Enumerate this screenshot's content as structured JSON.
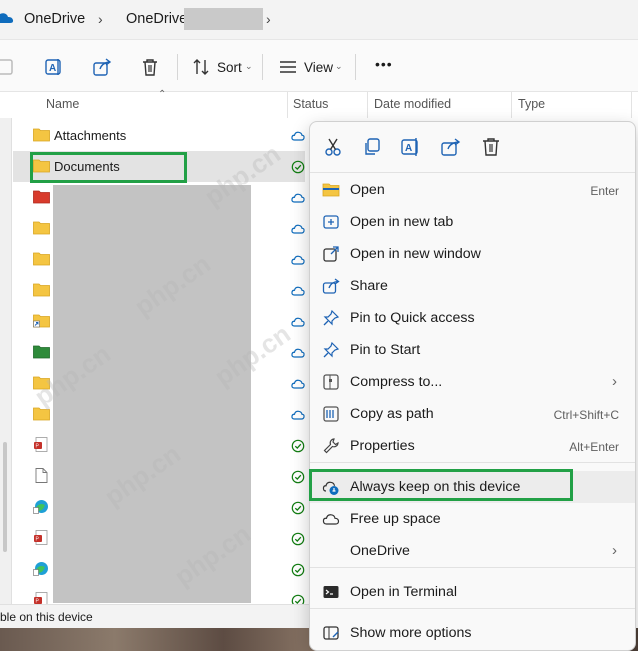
{
  "breadcrumb": {
    "root": "OneDrive",
    "current": "OneDrive"
  },
  "toolbar": {
    "sort_label": "Sort",
    "view_label": "View",
    "more_label": "•••"
  },
  "columns": {
    "name": "Name",
    "status": "Status",
    "date_modified": "Date modified",
    "type": "Type"
  },
  "files": [
    {
      "name": "Attachments",
      "icon": "folder-icon",
      "status": "cloud"
    },
    {
      "name": "Documents",
      "icon": "folder-icon",
      "status": "synced",
      "selected": true
    },
    {
      "name": "",
      "icon": "red-folder-icon",
      "status": "cloud"
    },
    {
      "name": "",
      "icon": "folder-icon",
      "status": "cloud"
    },
    {
      "name": "",
      "icon": "folder-icon",
      "status": "cloud"
    },
    {
      "name": "",
      "icon": "folder-icon",
      "status": "cloud"
    },
    {
      "name": "",
      "icon": "shortcut-icon",
      "status": "cloud"
    },
    {
      "name": "",
      "icon": "green-folder-icon",
      "status": "cloud"
    },
    {
      "name": "",
      "icon": "folder-icon",
      "status": "cloud"
    },
    {
      "name": "",
      "icon": "folder-icon",
      "status": "cloud"
    },
    {
      "name": "",
      "icon": "pdf-icon",
      "status": "synced"
    },
    {
      "name": "",
      "icon": "file-icon",
      "status": "synced"
    },
    {
      "name": "",
      "icon": "edge-icon",
      "status": "synced"
    },
    {
      "name": "",
      "icon": "pdf-icon",
      "status": "synced"
    },
    {
      "name": "",
      "icon": "edge-icon",
      "status": "synced"
    },
    {
      "name": "",
      "icon": "pdf-icon",
      "status": "synced"
    }
  ],
  "statusbar": {
    "text": "ble on this device"
  },
  "context_menu": {
    "quick_actions": [
      "cut-icon",
      "copy-icon",
      "rename-icon",
      "share-icon",
      "delete-icon"
    ],
    "items": [
      {
        "label": "Open",
        "shortcut": "Enter",
        "icon": "folder-open-icon"
      },
      {
        "label": "Open in new tab",
        "shortcut": "",
        "icon": "new-tab-icon"
      },
      {
        "label": "Open in new window",
        "shortcut": "",
        "icon": "new-window-icon"
      },
      {
        "label": "Share",
        "shortcut": "",
        "icon": "share-icon"
      },
      {
        "label": "Pin to Quick access",
        "shortcut": "",
        "icon": "pin-icon"
      },
      {
        "label": "Pin to Start",
        "shortcut": "",
        "icon": "pin-start-icon"
      },
      {
        "label": "Compress to...",
        "shortcut": "",
        "icon": "zip-icon",
        "submenu": true
      },
      {
        "label": "Copy as path",
        "shortcut": "Ctrl+Shift+C",
        "icon": "copy-path-icon"
      },
      {
        "label": "Properties",
        "shortcut": "Alt+Enter",
        "icon": "wrench-icon"
      },
      {
        "label": "Always keep on this device",
        "shortcut": "",
        "icon": "cloud-keep-icon"
      },
      {
        "label": "Free up space",
        "shortcut": "",
        "icon": "cloud-icon"
      },
      {
        "label": "OneDrive",
        "shortcut": "",
        "icon": "",
        "submenu": true
      },
      {
        "label": "Open in Terminal",
        "shortcut": "",
        "icon": "terminal-icon"
      },
      {
        "label": "Show more options",
        "shortcut": "",
        "icon": "more-options-icon"
      }
    ]
  },
  "watermark": "php.cn",
  "colors": {
    "accent_green": "#22a046",
    "folder_yellow": "#f4c542",
    "onedrive_blue": "#0f6cbd"
  }
}
